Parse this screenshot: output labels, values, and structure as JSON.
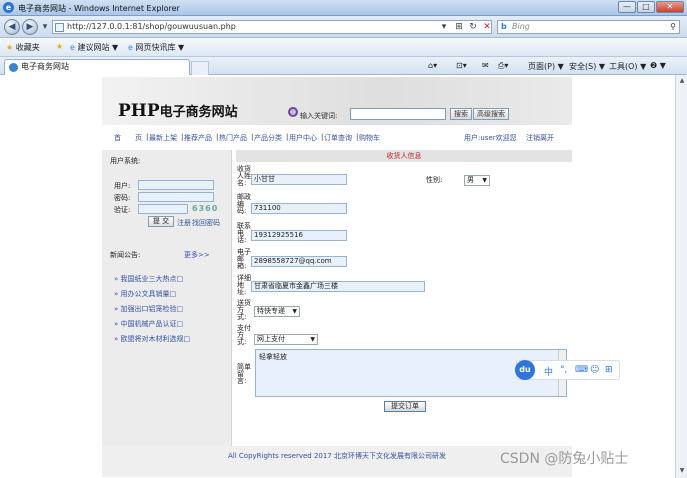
{
  "window": {
    "title": "电子商务网站 - Windows Internet Explorer",
    "min_label": "—",
    "max_label": "□",
    "close_label": "✕"
  },
  "address_bar": {
    "url": "http://127.0.0.1:81/shop/gouwuusuan.php",
    "search_placeholder": "Bing"
  },
  "favorites_bar": {
    "favorites_label": "收藏夹",
    "suggested_sites": "建议网站 ▼",
    "web_slice": "网页快讯库 ▼"
  },
  "tab": {
    "title": "电子商务网站"
  },
  "command_bar": {
    "page": "页面(P) ▼",
    "safety": "安全(S) ▼",
    "tools": "工具(O) ▼",
    "help": "❷ ▼"
  },
  "site": {
    "logo_text": "PHP",
    "logo_cn": "电子商务网站",
    "search_label": "输入关键词:",
    "search_button": "搜索",
    "advanced_button": "高级搜索"
  },
  "nav": {
    "items": [
      "首　　页",
      "最新上架",
      "推荐产品",
      "热门产品",
      "产品分类",
      "用户中心",
      "订单查询",
      "购物车"
    ],
    "user_welcome": "用户:user欢迎您",
    "logout": "注销离开"
  },
  "sidebar": {
    "system_heading": "用户系统:",
    "username_label": "用户:",
    "password_label": "密码:",
    "captcha_label": "验证:",
    "captcha_code": "6360",
    "submit_label": "提 交",
    "register_link": "注册",
    "forgot_link": "找回密码",
    "news_heading": "新闻公告:",
    "news_more": "更多>>",
    "news": [
      "» 我国纸业三大热点□",
      "» 用办公文具销量□",
      "» 加强出口铝笼检验□",
      "» 中国机械产品认证□",
      "» 欧盟将对木材利选规□"
    ]
  },
  "form": {
    "title": "收货人信息",
    "name_label": "收货人姓名:",
    "name_value": "小甘甘",
    "gender_label": "性别:",
    "gender_value": "男",
    "zip_label": "邮政编码:",
    "zip_value": "731100",
    "phone_label": "联系电话:",
    "phone_value": "19312925516",
    "email_label": "电子邮箱:",
    "email_value": "2898558727@qq.com",
    "address_label": "详细地址:",
    "address_value": "甘肃省临夏市金鑫广场三楼",
    "shipping_label": "送货方式:",
    "shipping_value": "特快专递",
    "payment_label": "支付方式:",
    "payment_value": "网上支付",
    "note_label": "简单留言:",
    "note_value": "轻拿轻放",
    "submit_label": "提交订单"
  },
  "footer": {
    "copyright": "All CopyRights reserved 2017 北京环博天下文化发展有限公司研发"
  },
  "ime": {
    "logo": "du",
    "mode": "中"
  },
  "watermark": "CSDN @防兔小贴士"
}
